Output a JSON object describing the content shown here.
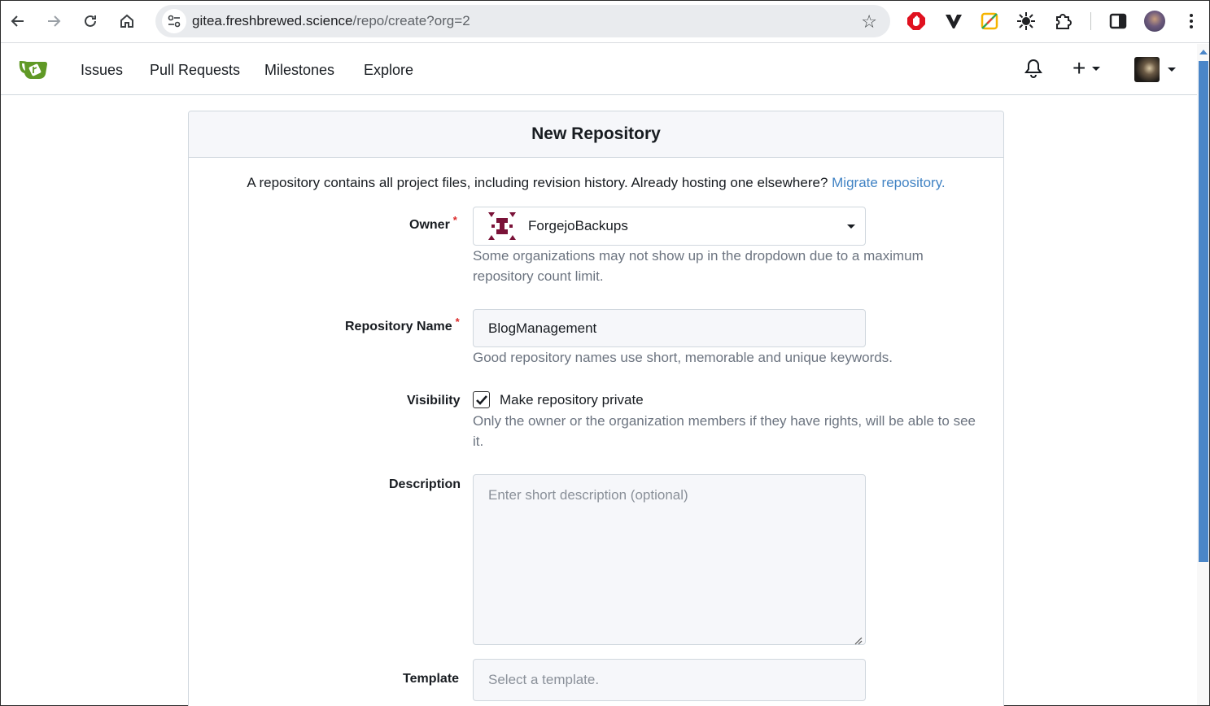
{
  "browser": {
    "url_host": "gitea.freshbrewed.science",
    "url_path": "/repo/create?org=2",
    "icons": [
      "back-arrow-icon",
      "forward-arrow-icon",
      "reload-icon",
      "home-icon",
      "site-settings-icon",
      "bookmark-star-icon",
      "ublock-icon",
      "vivaldi-v-icon",
      "color-picker-icon",
      "sunburst-icon",
      "extensions-puzzle-icon",
      "side-panel-icon",
      "profile-avatar-icon",
      "kebab-menu-icon"
    ]
  },
  "navbar": {
    "links": [
      "Issues",
      "Pull Requests",
      "Milestones",
      "Explore"
    ],
    "brand_color": "#609926"
  },
  "page": {
    "title": "New Repository",
    "intro_text": "A repository contains all project files, including revision history. Already hosting one elsewhere?",
    "migrate_link": "Migrate repository.",
    "link_color": "#4183c4"
  },
  "form": {
    "owner": {
      "label": "Owner",
      "required_mark": "*",
      "selected": "ForgejoBackups",
      "help": "Some organizations may not show up in the dropdown due to a maximum repository count limit."
    },
    "repo_name": {
      "label": "Repository Name",
      "required_mark": "*",
      "value": "BlogManagement",
      "help": "Good repository names use short, memorable and unique keywords."
    },
    "visibility": {
      "label": "Visibility",
      "checkbox_label": "Make repository private",
      "checked": true,
      "help": "Only the owner or the organization members if they have rights, will be able to see it."
    },
    "description": {
      "label": "Description",
      "placeholder": "Enter short description (optional)"
    },
    "template": {
      "label": "Template",
      "placeholder": "Select a template."
    }
  }
}
